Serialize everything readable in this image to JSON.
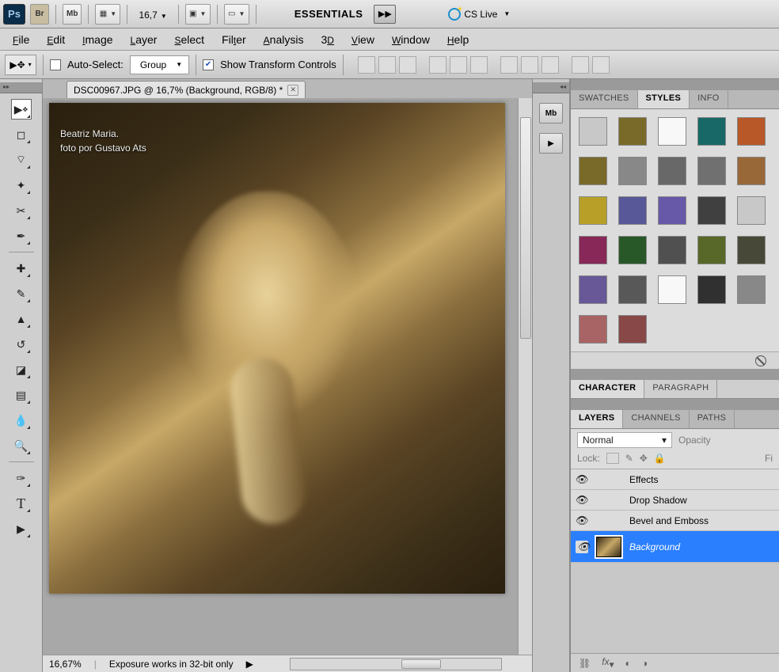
{
  "topbar": {
    "logo": "Ps",
    "br_label": "Br",
    "mb_label": "Mb",
    "zoom": "16,7",
    "workspace": "ESSENTIALS",
    "cslive": "CS Live"
  },
  "menu": [
    "File",
    "Edit",
    "Image",
    "Layer",
    "Select",
    "Filter",
    "Analysis",
    "3D",
    "View",
    "Window",
    "Help"
  ],
  "options": {
    "auto_select_label": "Auto-Select:",
    "group_label": "Group",
    "show_transform_label": "Show Transform Controls",
    "show_transform_checked": true
  },
  "document": {
    "tab_title": "DSC00967.JPG @ 16,7% (Background, RGB/8) *",
    "overlay_line1": "Beatriz Maria.",
    "overlay_line2": "foto por Gustavo Ats",
    "status_zoom": "16,67%",
    "status_msg": "Exposure works in 32-bit only"
  },
  "panels": {
    "swatches_tab": "SWATCHES",
    "styles_tab": "STYLES",
    "info_tab": "INFO",
    "character_tab": "CHARACTER",
    "paragraph_tab": "PARAGRAPH",
    "layers_tab": "LAYERS",
    "channels_tab": "CHANNELS",
    "paths_tab": "PATHS"
  },
  "styles": {
    "colors": [
      "#c8c8c8",
      "#7a6a2a",
      "#f8f8f8",
      "#186868",
      "#b85828",
      "#7a6a2a",
      "#888888",
      "#686868",
      "#707070",
      "#986838",
      "#b8a028",
      "#585898",
      "#6858a8",
      "#404040",
      "#c8c8c8",
      "#882858",
      "#285828",
      "#505050",
      "#586828",
      "#484838",
      "#685898",
      "#585858",
      "#f8f8f8",
      "#303030",
      "#888888",
      "#a86464",
      "#884848"
    ]
  },
  "layers": {
    "blend_mode": "Normal",
    "opacity_label": "Opacity",
    "lock_label": "Lock:",
    "fill_label": "Fi",
    "effects_label": "Effects",
    "drop_shadow_label": "Drop Shadow",
    "bevel_label": "Bevel and Emboss",
    "bg_layer_label": "Background",
    "footer_fx": "fx"
  }
}
